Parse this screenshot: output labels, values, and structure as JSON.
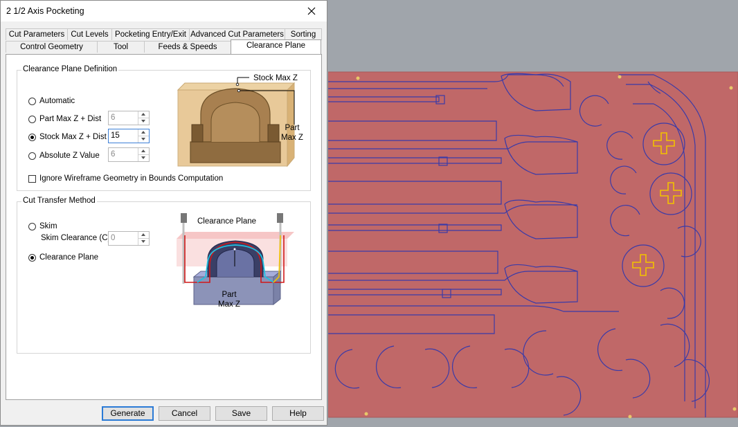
{
  "dialog": {
    "title": "2 1/2 Axis Pocketing",
    "tabs_row1": [
      "Cut Parameters",
      "Cut Levels",
      "Pocketing Entry/Exit",
      "Advanced Cut Parameters",
      "Sorting"
    ],
    "tabs_row2": [
      "Control Geometry",
      "Tool",
      "Feeds & Speeds",
      "Clearance Plane"
    ],
    "active_tab": "Clearance Plane"
  },
  "clearance_plane_definition": {
    "legend": "Clearance Plane Definition",
    "options": [
      {
        "label": "Automatic",
        "checked": false
      },
      {
        "label": "Part Max Z + Dist",
        "checked": false,
        "value": "6"
      },
      {
        "label": "Stock Max Z + Dist",
        "checked": true,
        "value": "15"
      },
      {
        "label": "Absolute Z Value",
        "checked": false,
        "value": "6"
      }
    ],
    "ignore_wireframe_label": "Ignore Wireframe Geometry in Bounds Computation",
    "ignore_wireframe_checked": false,
    "illustration": {
      "stock_max_z_label": "Stock Max Z",
      "part_max_z_label_1": "Part",
      "part_max_z_label_2": "Max Z"
    }
  },
  "cut_transfer_method": {
    "legend": "Cut Transfer Method",
    "skim_label": "Skim",
    "skim_checked": false,
    "skim_clearance_label": "Skim Clearance (C)",
    "skim_clearance_value": "0",
    "clearance_plane_label": "Clearance Plane",
    "clearance_plane_checked": true,
    "illustration": {
      "clearance_plane_label": "Clearance Plane",
      "part_max_z_label_1": "Part",
      "part_max_z_label_2": "Max Z"
    }
  },
  "buttons": {
    "generate": "Generate",
    "cancel": "Cancel",
    "save": "Save",
    "help": "Help"
  },
  "colors": {
    "stock": "#c06868",
    "toolpath": "#3a3aa8",
    "highlight": "#f2c200",
    "accent": "#2a7ad6"
  }
}
